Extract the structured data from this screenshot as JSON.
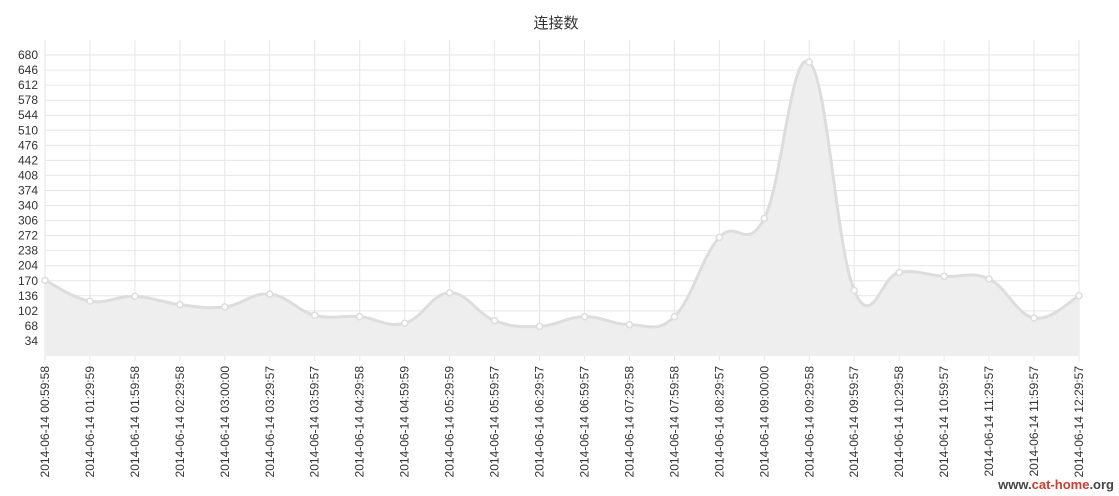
{
  "chart_data": {
    "type": "area",
    "title": "连接数",
    "xlabel": "",
    "ylabel": "",
    "categories": [
      "2014-06-14 00:59:58",
      "2014-06-14 01:29:59",
      "2014-06-14 01:59:58",
      "2014-06-14 02:29:58",
      "2014-06-14 03:00:00",
      "2014-06-14 03:29:57",
      "2014-06-14 03:59:57",
      "2014-06-14 04:29:58",
      "2014-06-14 04:59:59",
      "2014-06-14 05:29:59",
      "2014-06-14 05:59:57",
      "2014-06-14 06:29:57",
      "2014-06-14 06:59:57",
      "2014-06-14 07:29:58",
      "2014-06-14 07:59:58",
      "2014-06-14 08:29:57",
      "2014-06-14 09:00:00",
      "2014-06-14 09:29:58",
      "2014-06-14 09:59:57",
      "2014-06-14 10:29:58",
      "2014-06-14 10:59:57",
      "2014-06-14 11:29:57",
      "2014-06-14 11:59:57",
      "2014-06-14 12:29:57"
    ],
    "series": [
      {
        "values": [
          171,
          124,
          135,
          116,
          111,
          140,
          92,
          89,
          74,
          143,
          80,
          67,
          89,
          71,
          89,
          268,
          311,
          664,
          148,
          189,
          180,
          174,
          86,
          136
        ]
      }
    ],
    "yticks": [
      34,
      68,
      102,
      136,
      170,
      204,
      238,
      272,
      306,
      340,
      374,
      408,
      442,
      476,
      510,
      544,
      578,
      612,
      646,
      680
    ],
    "ylim": [
      0,
      714
    ],
    "grid": true,
    "legend": "none",
    "colors": {
      "line": "#dddddd",
      "fill": "#eeeeee",
      "grid": "#e6e6e6",
      "point_fill": "#ffffff",
      "text": "#333333"
    }
  },
  "watermark": {
    "prefix": "www.",
    "brand": "cat-home",
    "suffix": ".org"
  }
}
